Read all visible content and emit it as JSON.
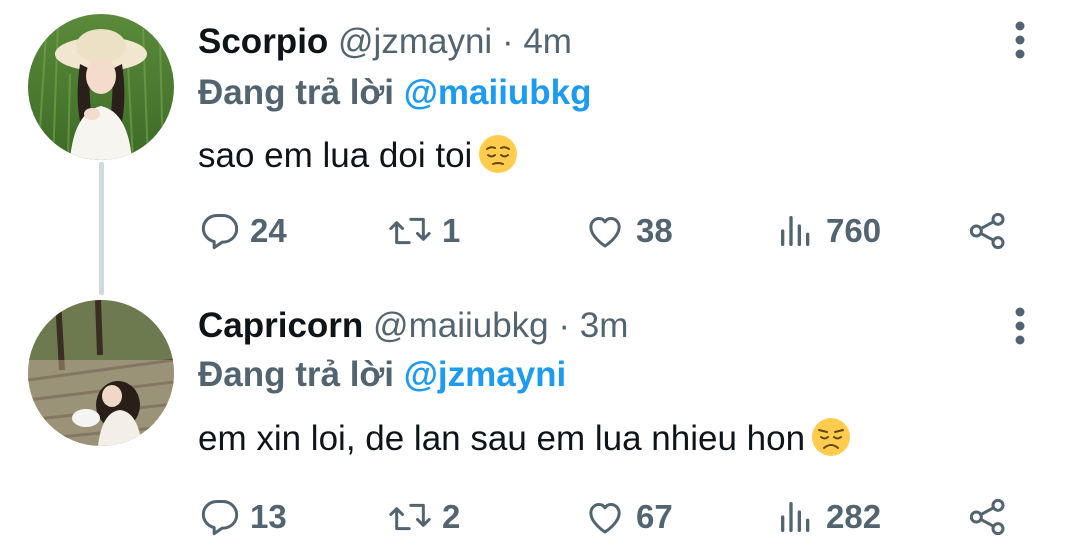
{
  "tweets": [
    {
      "name": "Scorpio",
      "handle": "@jzmayni",
      "separator": "·",
      "time": "4m",
      "reply_prefix": "Đang trả lời",
      "reply_to": "@maiiubkg",
      "text": "sao em lua doi toi",
      "emoji": "pensive-face-emoji",
      "avatar": "avatar-woman-in-sunhat",
      "replies": "24",
      "retweets": "1",
      "likes": "38",
      "views": "760"
    },
    {
      "name": "Capricorn",
      "handle": "@maiiubkg",
      "separator": "·",
      "time": "3m",
      "reply_prefix": "Đang trả lời",
      "reply_to": "@jzmayni",
      "text": "em xin loi, de lan sau em lua nhieu hon",
      "emoji": "disappointed-face-emoji",
      "avatar": "avatar-girl-on-wooden-deck",
      "replies": "13",
      "retweets": "2",
      "likes": "67",
      "views": "282"
    }
  ],
  "colors": {
    "text_primary": "#0f1419",
    "text_secondary": "#536471",
    "mention_blue": "#1d9bf0",
    "thread_line": "#cfd9de",
    "emoji_yellow": "#ffcc4d"
  },
  "icons": [
    "reply-icon",
    "retweet-icon",
    "like-icon",
    "views-icon",
    "share-icon",
    "more-options-icon"
  ]
}
